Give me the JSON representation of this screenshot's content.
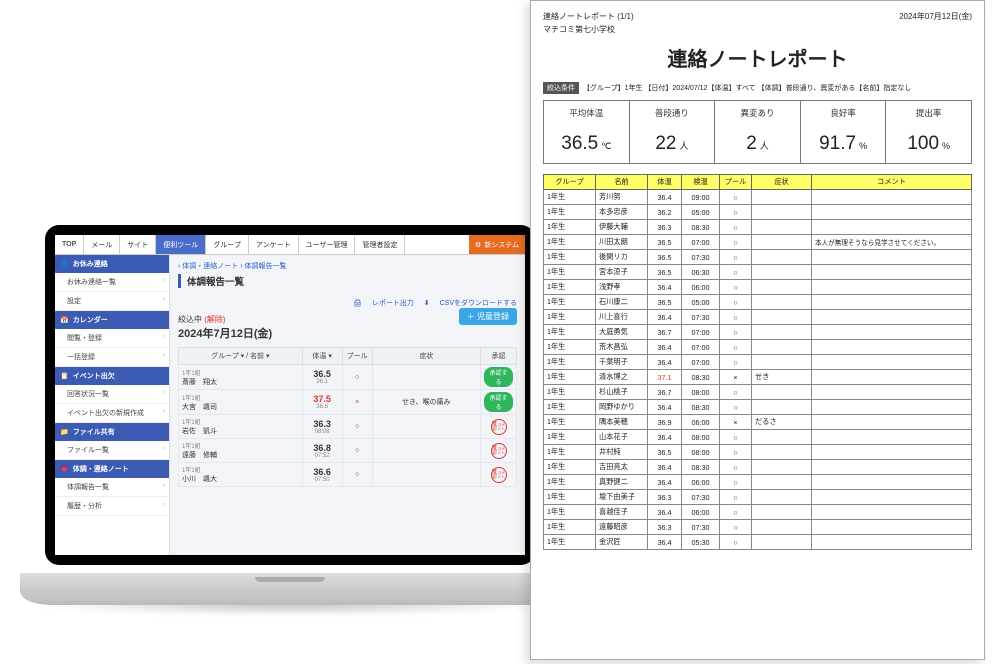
{
  "laptop": {
    "tabs": [
      "TOP",
      "メール",
      "サイト",
      "便利ツール",
      "グループ",
      "アンケート",
      "ユーザー管理",
      "管理者設定"
    ],
    "active_tab_index": 3,
    "newsys_btn": "新システム",
    "sidebar": [
      {
        "header": "お休み連絡",
        "items": [
          "お休み連絡一覧",
          "設定"
        ]
      },
      {
        "header": "カレンダー",
        "items": [
          "閲覧・登録",
          "一括登録"
        ]
      },
      {
        "header": "イベント出欠",
        "items": [
          "回答状況一覧",
          "イベント出欠の新規作成"
        ]
      },
      {
        "header": "ファイル共有",
        "items": [
          "ファイル一覧"
        ]
      },
      {
        "header": "体調・連絡ノート",
        "items": [
          "体調報告一覧",
          "履歴・分析"
        ]
      }
    ],
    "crumb": "体調・連絡ノート › 体調報告一覧",
    "page_title": "体調報告一覧",
    "action_report": "レポート出力",
    "action_csv": "CSVをダウンロードする",
    "filter_label": "絞込中",
    "filter_clear": "(解除)",
    "filter_date": "2024年7月12日(金)",
    "add_child": "＋ 児童登録",
    "cols": {
      "group_name": "グループ ▾ / 名前 ▾",
      "temp": "体温 ▾",
      "pool": "プール",
      "symptom": "症状",
      "approve": "承認"
    },
    "rows": [
      {
        "grp": "1年1組",
        "name": "斎藤　翔太",
        "temp": "36.5",
        "sub": "36.1",
        "pool": "○",
        "sym": "",
        "approve": "btn"
      },
      {
        "grp": "1年1組",
        "name": "大宮　颯司",
        "temp": "37.5",
        "sub": "36.6",
        "pool": "×",
        "sym": "せき、喉の痛み",
        "approve": "btn",
        "hot": true
      },
      {
        "grp": "1年1組",
        "name": "岩佐　凱斗",
        "temp": "36.3",
        "sub": "08:08",
        "pool": "○",
        "sym": "",
        "approve": "stamp"
      },
      {
        "grp": "1年1組",
        "name": "遠藤　修輔",
        "temp": "36.8",
        "sub": "07:52",
        "pool": "○",
        "sym": "",
        "approve": "stamp"
      },
      {
        "grp": "1年1組",
        "name": "小川　颯大",
        "temp": "36.6",
        "sub": "07:50",
        "pool": "○",
        "sym": "",
        "approve": "stamp"
      }
    ],
    "approve_label": "承認する",
    "stamp_top": "確認",
    "stamp_bot": "コメント"
  },
  "paper": {
    "top_left": "連絡ノートレポート (1/1)",
    "top_right": "2024年07月12日(金)",
    "school": "マチコミ第七小学校",
    "title": "連絡ノートレポート",
    "cond_tag": "絞込条件",
    "cond_text": "【グループ】1年生 【日付】2024/07/12【体温】すべて 【体調】普段通り、異変がある【名前】指定なし",
    "stats": [
      {
        "lbl": "平均体温",
        "val": "36.5",
        "unit": "℃"
      },
      {
        "lbl": "普段通り",
        "val": "22",
        "unit": "人"
      },
      {
        "lbl": "異変あり",
        "val": "2",
        "unit": "人"
      },
      {
        "lbl": "良好率",
        "val": "91.7",
        "unit": "%"
      },
      {
        "lbl": "提出率",
        "val": "100",
        "unit": "%"
      }
    ],
    "cols": [
      "グループ",
      "名前",
      "体温",
      "検温",
      "プール",
      "症状",
      "コメント"
    ],
    "rows": [
      {
        "g": "1年生",
        "n": "芳川努",
        "t": "36.4",
        "ti": "09:00",
        "p": "○",
        "s": "",
        "c": ""
      },
      {
        "g": "1年生",
        "n": "本多忠彦",
        "t": "36.2",
        "ti": "05:00",
        "p": "○",
        "s": "",
        "c": ""
      },
      {
        "g": "1年生",
        "n": "伊藤大輔",
        "t": "36.3",
        "ti": "08:30",
        "p": "○",
        "s": "",
        "c": ""
      },
      {
        "g": "1年生",
        "n": "川田太朗",
        "t": "36.5",
        "ti": "07:00",
        "p": "○",
        "s": "",
        "c": "本人が無理そうなら見学させてください。"
      },
      {
        "g": "1年生",
        "n": "後関リカ",
        "t": "36.5",
        "ti": "07:30",
        "p": "○",
        "s": "",
        "c": ""
      },
      {
        "g": "1年生",
        "n": "宮本涼子",
        "t": "36.5",
        "ti": "06:30",
        "p": "○",
        "s": "",
        "c": ""
      },
      {
        "g": "1年生",
        "n": "浅野孝",
        "t": "36.4",
        "ti": "06:00",
        "p": "○",
        "s": "",
        "c": ""
      },
      {
        "g": "1年生",
        "n": "石川康二",
        "t": "36.5",
        "ti": "05:00",
        "p": "○",
        "s": "",
        "c": ""
      },
      {
        "g": "1年生",
        "n": "川上喜行",
        "t": "36.4",
        "ti": "07:30",
        "p": "○",
        "s": "",
        "c": ""
      },
      {
        "g": "1年生",
        "n": "大庭勇気",
        "t": "36.7",
        "ti": "07:00",
        "p": "○",
        "s": "",
        "c": ""
      },
      {
        "g": "1年生",
        "n": "荒木昌弘",
        "t": "36.4",
        "ti": "07:00",
        "p": "○",
        "s": "",
        "c": ""
      },
      {
        "g": "1年生",
        "n": "千葉明子",
        "t": "36.4",
        "ti": "07:00",
        "p": "○",
        "s": "",
        "c": ""
      },
      {
        "g": "1年生",
        "n": "清水博之",
        "t": "37.1",
        "ti": "08:30",
        "p": "×",
        "s": "せき",
        "c": "",
        "hot": true
      },
      {
        "g": "1年生",
        "n": "杉山桃子",
        "t": "36.7",
        "ti": "08:00",
        "p": "○",
        "s": "",
        "c": ""
      },
      {
        "g": "1年生",
        "n": "岡野ゆかり",
        "t": "36.4",
        "ti": "08:30",
        "p": "○",
        "s": "",
        "c": ""
      },
      {
        "g": "1年生",
        "n": "隅本美穂",
        "t": "36.9",
        "ti": "06:00",
        "p": "×",
        "s": "だるさ",
        "c": ""
      },
      {
        "g": "1年生",
        "n": "山本花子",
        "t": "36.4",
        "ti": "08:00",
        "p": "○",
        "s": "",
        "c": ""
      },
      {
        "g": "1年生",
        "n": "井村純",
        "t": "36.5",
        "ti": "08:00",
        "p": "○",
        "s": "",
        "c": ""
      },
      {
        "g": "1年生",
        "n": "吉田亮太",
        "t": "36.4",
        "ti": "08:30",
        "p": "○",
        "s": "",
        "c": ""
      },
      {
        "g": "1年生",
        "n": "真野健二",
        "t": "36.4",
        "ti": "06:00",
        "p": "○",
        "s": "",
        "c": ""
      },
      {
        "g": "1年生",
        "n": "壇下由美子",
        "t": "36.3",
        "ti": "07:30",
        "p": "○",
        "s": "",
        "c": ""
      },
      {
        "g": "1年生",
        "n": "喜越佳子",
        "t": "36.4",
        "ti": "06:00",
        "p": "○",
        "s": "",
        "c": ""
      },
      {
        "g": "1年生",
        "n": "遠藤昭彦",
        "t": "36.3",
        "ti": "07:30",
        "p": "○",
        "s": "",
        "c": ""
      },
      {
        "g": "1年生",
        "n": "金沢匠",
        "t": "36.4",
        "ti": "05:30",
        "p": "○",
        "s": "",
        "c": ""
      }
    ]
  }
}
